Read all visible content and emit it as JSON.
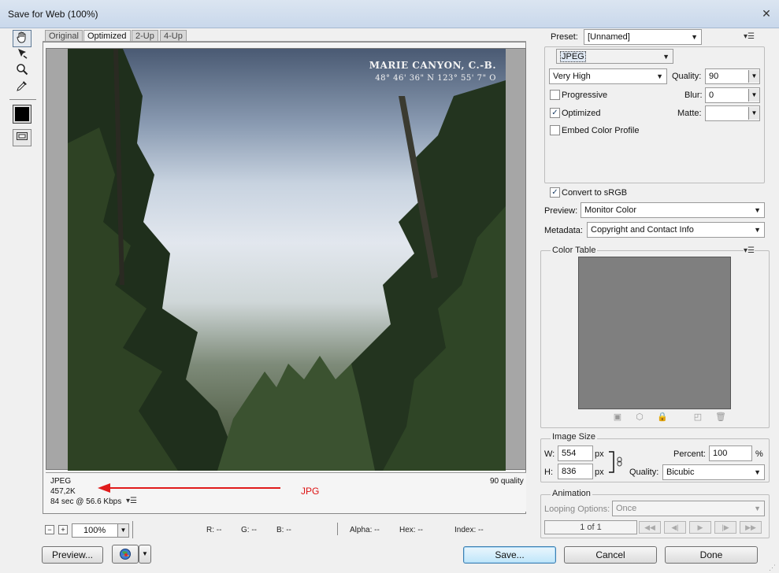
{
  "window": {
    "title": "Save for Web (100%)",
    "close_glyph": "✕"
  },
  "toolbar": {
    "hand_tool": "hand-icon",
    "slice_select_tool": "slice-select-icon",
    "zoom_tool": "zoom-icon",
    "eyedropper_tool": "eyedropper-icon",
    "eyedropper_color": "#000000",
    "toggle_slices": "slice-visibility-icon"
  },
  "tabs": [
    {
      "label": "Original",
      "active": false
    },
    {
      "label": "Optimized",
      "active": true
    },
    {
      "label": "2-Up",
      "active": false
    },
    {
      "label": "4-Up",
      "active": false
    }
  ],
  "preview": {
    "caption_title": "MARIE CANYON, C.-B.",
    "caption_coords": "48° 46' 36\" N    123° 55' 7\" O",
    "format": "JPEG",
    "size": "457,2K",
    "download_time": "84 sec @ 56.6 Kbps",
    "quality_text": "90 quality",
    "annotation_label": "JPG",
    "annotation_color": "#dd1111"
  },
  "status_bar": {
    "zoom_out": "−",
    "zoom_in": "+",
    "zoom": "100%",
    "r": "R: --",
    "g": "G: --",
    "b": "B: --",
    "alpha": "Alpha: --",
    "hex": "Hex: --",
    "index": "Index: --"
  },
  "buttons": {
    "preview": "Preview...",
    "save": "Save...",
    "cancel": "Cancel",
    "done": "Done"
  },
  "settings": {
    "preset_label": "Preset:",
    "preset_value": "[Unnamed]",
    "format_value": "JPEG",
    "compression_value": "Very High",
    "quality_label": "Quality:",
    "quality_value": "90",
    "progressive_label": "Progressive",
    "progressive_checked": false,
    "blur_label": "Blur:",
    "blur_value": "0",
    "optimized_label": "Optimized",
    "optimized_checked": true,
    "matte_label": "Matte:",
    "matte_value": "",
    "embed_profile_label": "Embed Color Profile",
    "embed_profile_checked": false,
    "convert_srgb_label": "Convert to sRGB",
    "convert_srgb_checked": true,
    "preview_label": "Preview:",
    "preview_value": "Monitor Color",
    "metadata_label": "Metadata:",
    "metadata_value": "Copyright and Contact Info"
  },
  "color_table": {
    "title": "Color Table",
    "background_color": "#7f7f7f"
  },
  "image_size": {
    "title": "Image Size",
    "w_label": "W:",
    "w_value": "554",
    "h_label": "H:",
    "h_value": "836",
    "unit": "px",
    "percent_label": "Percent:",
    "percent_value": "100",
    "percent_unit": "%",
    "quality_label": "Quality:",
    "quality_value": "Bicubic"
  },
  "animation": {
    "title": "Animation",
    "looping_label": "Looping Options:",
    "looping_value": "Once",
    "frame_counter": "1 of 1"
  }
}
